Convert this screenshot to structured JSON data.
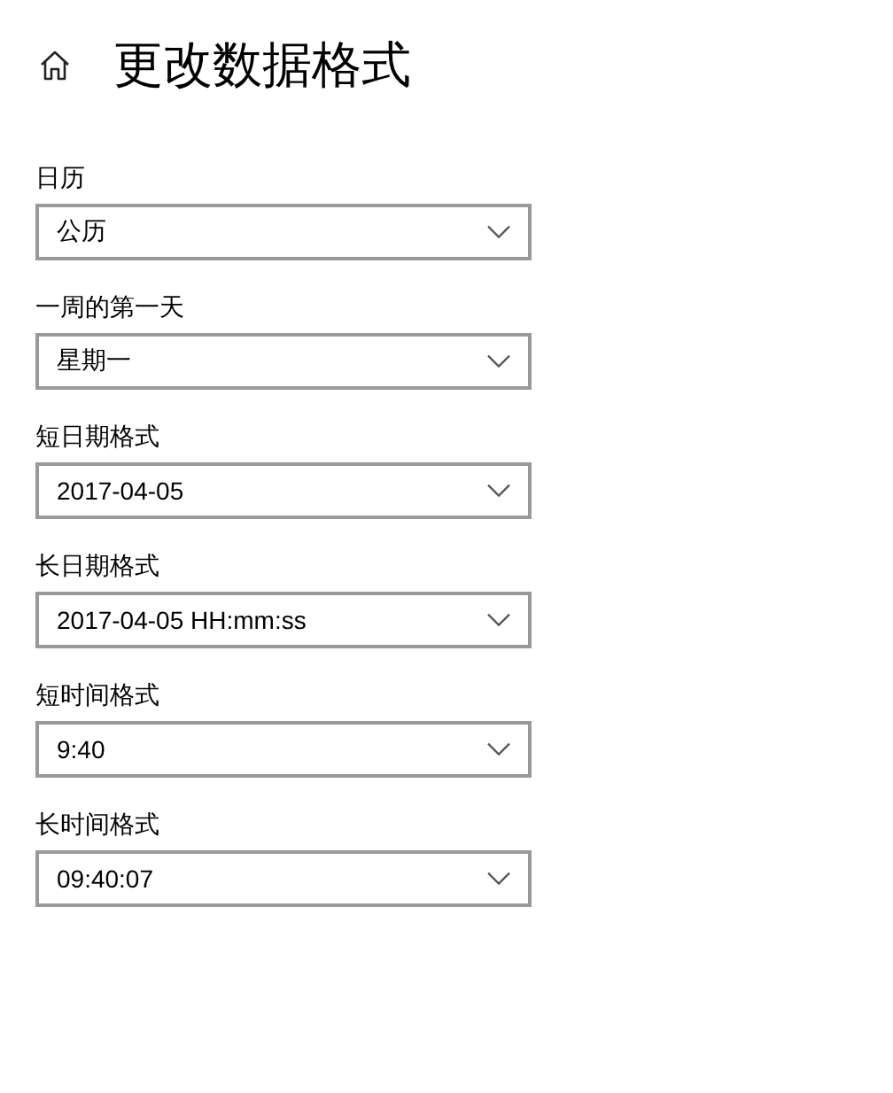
{
  "page": {
    "title": "更改数据格式"
  },
  "settings": [
    {
      "label": "日历",
      "value": "公历"
    },
    {
      "label": "一周的第一天",
      "value": "星期一"
    },
    {
      "label": "短日期格式",
      "value": "2017-04-05"
    },
    {
      "label": "长日期格式",
      "value": "2017-04-05 HH:mm:ss"
    },
    {
      "label": "短时间格式",
      "value": "9:40"
    },
    {
      "label": "长时间格式",
      "value": "09:40:07"
    }
  ]
}
